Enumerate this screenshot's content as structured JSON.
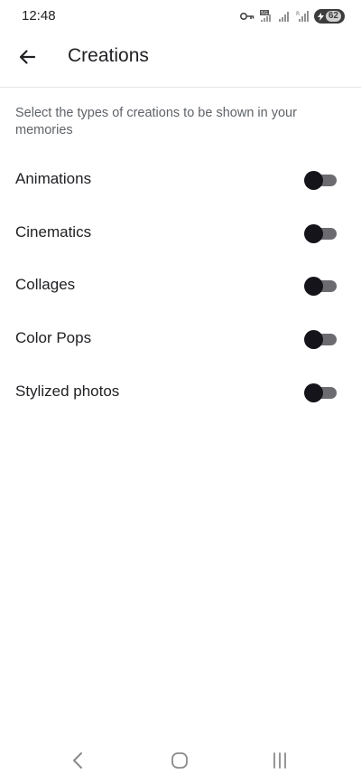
{
  "status_bar": {
    "time": "12:48",
    "battery_level": "62",
    "icons": [
      "vpn-key-icon",
      "5g-signal-icon",
      "signal-bars-icon",
      "signal-bars-icon",
      "battery-icon"
    ]
  },
  "app_bar": {
    "back_icon": "arrow-left-icon",
    "title": "Creations"
  },
  "description": "Select the types of creations to be shown in your memories",
  "toggles": [
    {
      "label": "Animations",
      "enabled": false
    },
    {
      "label": "Cinematics",
      "enabled": false
    },
    {
      "label": "Collages",
      "enabled": false
    },
    {
      "label": "Color Pops",
      "enabled": false
    },
    {
      "label": "Stylized photos",
      "enabled": false
    }
  ],
  "nav_bar": {
    "icons": [
      "nav-back-icon",
      "nav-home-icon",
      "nav-recents-icon"
    ]
  },
  "colors": {
    "switch_thumb_off": "#15141a",
    "switch_track_off": "#6b6b70",
    "divider": "#e6e6e6",
    "secondary_text": "#5f6368"
  }
}
